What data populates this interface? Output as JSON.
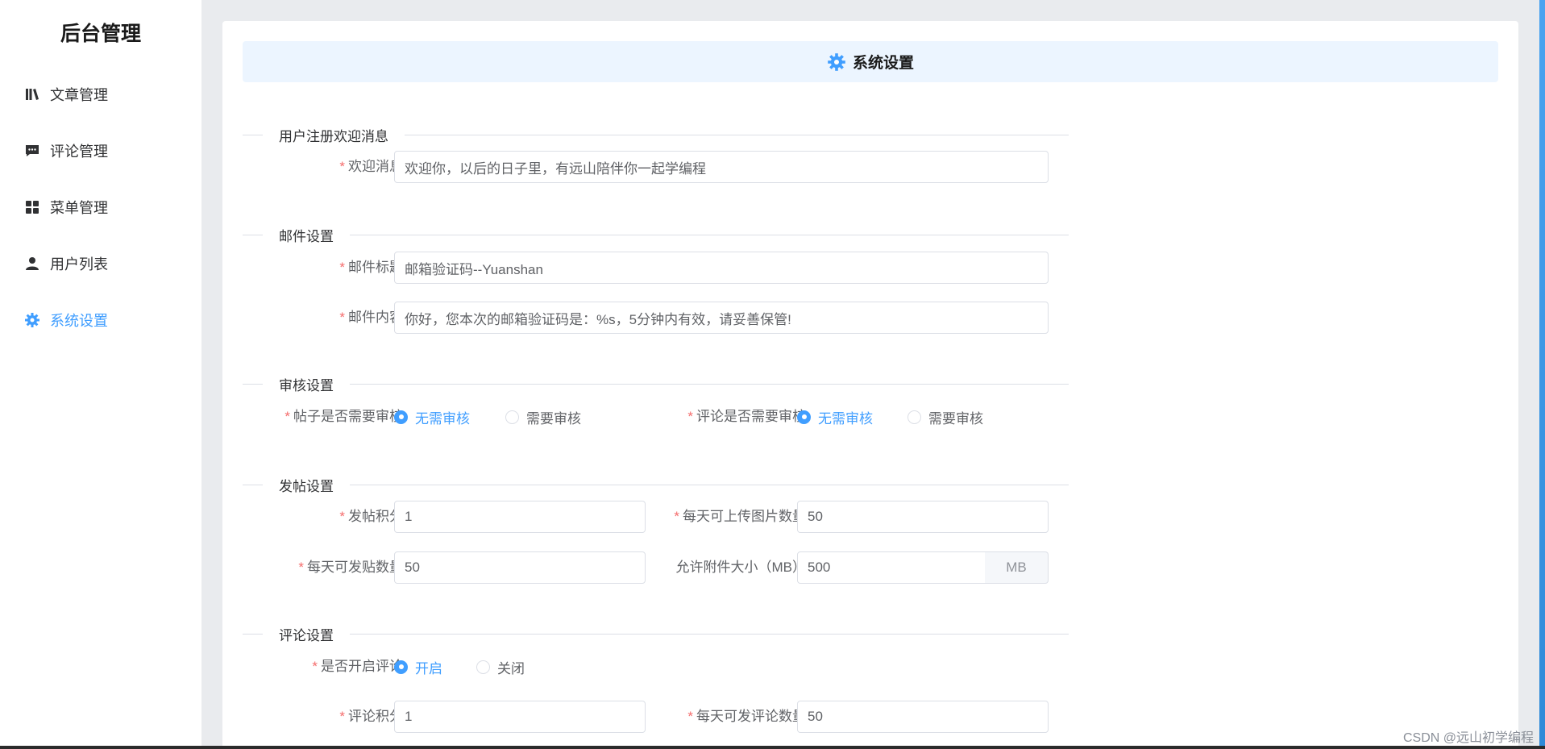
{
  "sidebar": {
    "title": "后台管理",
    "items": [
      {
        "label": "文章管理",
        "icon": "book-icon"
      },
      {
        "label": "评论管理",
        "icon": "comment-icon"
      },
      {
        "label": "菜单管理",
        "icon": "grid-icon"
      },
      {
        "label": "用户列表",
        "icon": "user-icon"
      },
      {
        "label": "系统设置",
        "icon": "gear-icon",
        "active": true
      }
    ]
  },
  "header": {
    "title": "系统设置",
    "icon": "gear-icon"
  },
  "sections": {
    "welcome": {
      "title": "用户注册欢迎消息",
      "welcome_label": "欢迎消息",
      "welcome_value": "欢迎你，以后的日子里，有远山陪伴你一起学编程"
    },
    "email": {
      "title": "邮件设置",
      "subject_label": "邮件标题",
      "subject_value": "邮箱验证码--Yuanshan",
      "content_label": "邮件内容",
      "content_value": "你好，您本次的邮箱验证码是：%s，5分钟内有效，请妥善保管!"
    },
    "audit": {
      "title": "审核设置",
      "post_label": "帖子是否需要审核",
      "post_options": [
        "无需审核",
        "需要审核"
      ],
      "post_selected": "无需审核",
      "comment_label": "评论是否需要审核",
      "comment_options": [
        "无需审核",
        "需要审核"
      ],
      "comment_selected": "无需审核"
    },
    "post": {
      "title": "发帖设置",
      "points_label": "发帖积分",
      "points_value": "1",
      "upload_label": "每天可上传图片数量",
      "upload_value": "50",
      "daily_label": "每天可发贴数量",
      "daily_value": "50",
      "attach_label": "允许附件大小（MB）",
      "attach_value": "500",
      "attach_unit": "MB"
    },
    "comment": {
      "title": "评论设置",
      "enable_label": "是否开启评论",
      "enable_options": [
        "开启",
        "关闭"
      ],
      "enable_selected": "开启",
      "points_label": "评论积分",
      "points_value": "1",
      "daily_label": "每天可发评论数量",
      "daily_value": "50"
    }
  },
  "watermark": "CSDN @远山初学编程",
  "colors": {
    "accent": "#409eff",
    "required": "#f56c6c",
    "header_bg": "#ecf5ff"
  }
}
